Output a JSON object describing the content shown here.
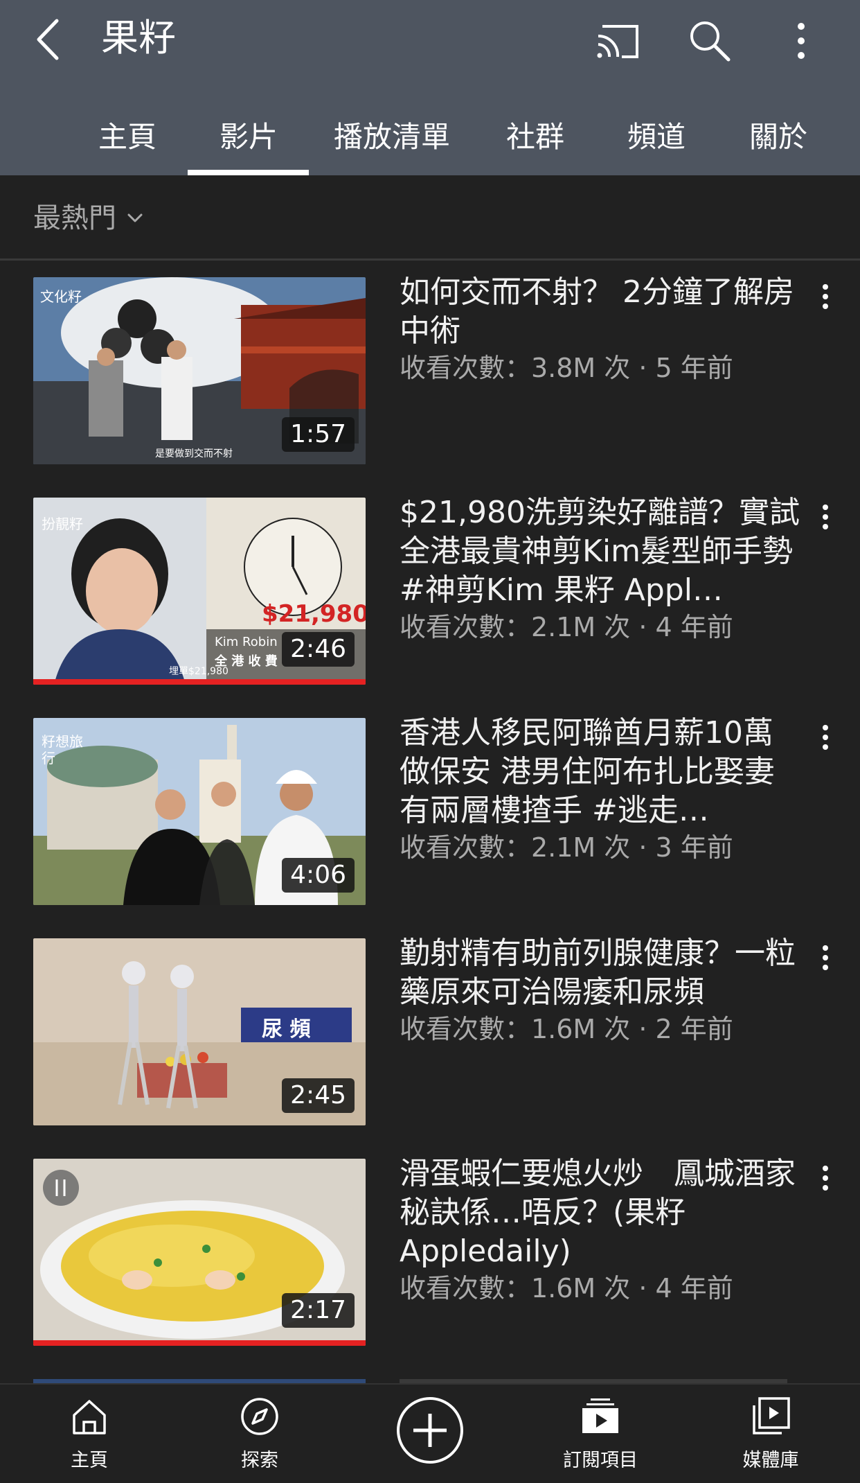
{
  "header": {
    "channel_title": "果籽",
    "tabs": [
      "主頁",
      "影片",
      "播放清單",
      "社群",
      "頻道",
      "關於"
    ],
    "active_tab": "影片"
  },
  "sort": {
    "label": "最熱門"
  },
  "videos": [
    {
      "title": "如何交而不射？ 2分鐘了解房中術",
      "meta": "收看次數：3.8M 次 · 5 年前",
      "duration": "1:57",
      "thumb_badge": "文化籽",
      "thumb_caption": "是要做到交而不射",
      "progress": 0
    },
    {
      "title": "$21,980洗剪染好離譜？實試全港最貴神剪Kim髮型師手勢 #神剪Kim 果籽 Appl…",
      "meta": "收看次數：2.1M 次 · 4 年前",
      "duration": "2:46",
      "thumb_badge": "扮靚籽",
      "thumb_price": "$21,980",
      "thumb_name": "Kim Robin",
      "thumb_text": "全 港 收 費",
      "thumb_caption": "埋單$21,980",
      "progress": 1.0
    },
    {
      "title": "香港人移民阿聯酋月薪10萬做保安 港男住阿布扎比娶妻有兩層樓揸手 #逃走…",
      "meta": "收看次數：2.1M 次 · 3 年前",
      "duration": "4:06",
      "thumb_badge": "籽想旅行",
      "progress": 0
    },
    {
      "title": "勤射精有助前列腺健康？一粒藥原來可治陽痿和尿頻",
      "meta": "收看次數：1.6M 次 · 2 年前",
      "duration": "2:45",
      "thumb_label": "尿 頻",
      "progress": 0
    },
    {
      "title": "滑蛋蝦仁要熄火炒　鳳城酒家秘訣係…唔反？(果籽 Appledaily)",
      "meta": "收看次數：1.6M 次 · 4 年前",
      "duration": "2:17",
      "progress": 1.0
    }
  ],
  "bottom_nav": {
    "items": [
      "主頁",
      "探索",
      "",
      "訂閱項目",
      "媒體庫"
    ]
  },
  "colors": {
    "header_bg": "#4e5560",
    "page_bg": "#212121",
    "progress": "#e52222",
    "meta": "#aaaaaa"
  }
}
